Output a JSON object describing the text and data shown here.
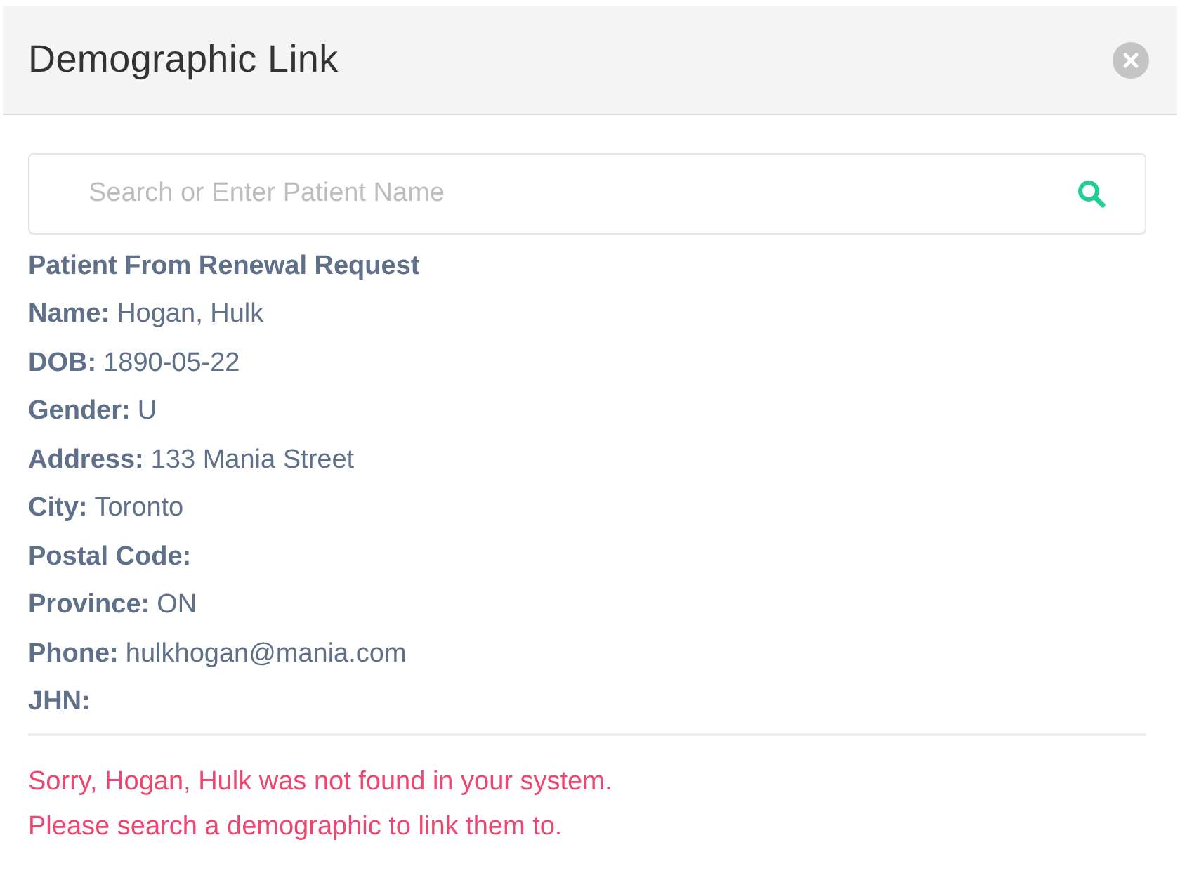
{
  "dialog": {
    "title": "Demographic Link"
  },
  "search": {
    "placeholder": "Search or Enter Patient Name"
  },
  "patient": {
    "heading": "Patient From Renewal Request",
    "fields": [
      {
        "label": "Name:",
        "value": "Hogan, Hulk"
      },
      {
        "label": "DOB:",
        "value": "1890-05-22"
      },
      {
        "label": "Gender:",
        "value": "U"
      },
      {
        "label": "Address:",
        "value": "133 Mania Street"
      },
      {
        "label": "City:",
        "value": "Toronto"
      },
      {
        "label": "Postal Code:"
      },
      {
        "label": "Province:",
        "value": "ON"
      },
      {
        "label": "Phone:",
        "value": "hulkhogan@mania.com"
      },
      {
        "label": "JHN:"
      }
    ]
  },
  "messages": [
    "Sorry, Hogan, Hulk was not found in your system.",
    "Please search a demographic to link them to."
  ]
}
